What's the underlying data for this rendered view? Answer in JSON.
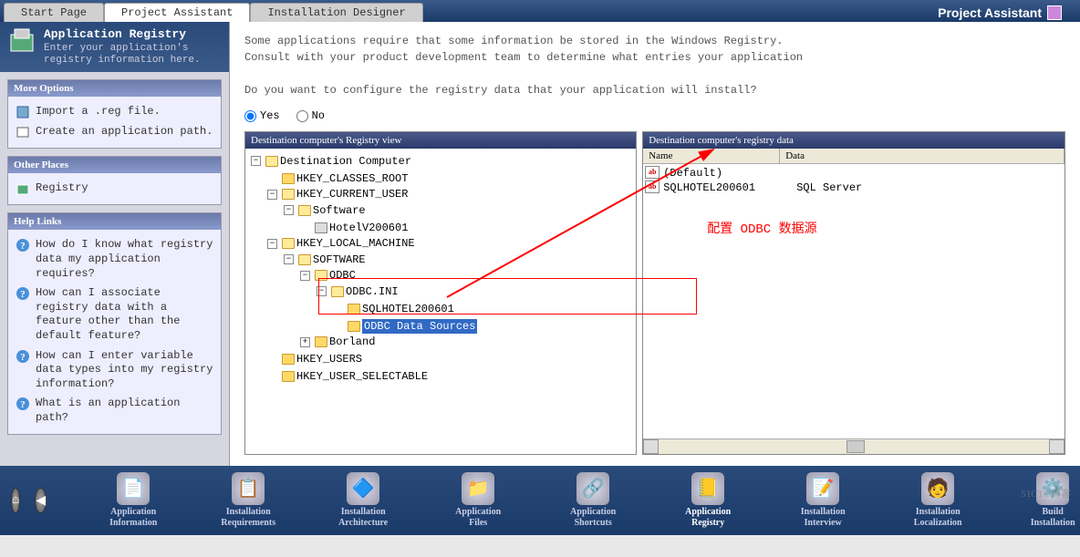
{
  "tabs": [
    "Start Page",
    "Project Assistant",
    "Installation Designer"
  ],
  "active_tab": 1,
  "app_title": "Project Assistant",
  "sidebar": {
    "header_title": "Application Registry",
    "header_desc": "Enter your application's registry information here.",
    "more_options_title": "More Options",
    "more_options": [
      "Import a .reg file.",
      "Create an application path."
    ],
    "other_places_title": "Other Places",
    "other_places": [
      "Registry"
    ],
    "help_title": "Help Links",
    "help_links": [
      "How do I know what registry data my application requires?",
      "How can I associate registry data with a feature other than the default feature?",
      "How can I enter variable data types into my registry information?",
      "What is an application path?"
    ]
  },
  "main": {
    "desc1": "Some applications require that some information be stored in the Windows Registry.",
    "desc2": "Consult with your product development team to determine what entries your application",
    "desc3": "Do you want to configure the registry data that your application will install?",
    "yes": "Yes",
    "no": "No",
    "tree_title": "Destination computer's Registry view",
    "data_title": "Destination computer's registry data",
    "col_name": "Name",
    "col_data": "Data",
    "tree": {
      "root": "Destination Computer",
      "hkcr": "HKEY_CLASSES_ROOT",
      "hkcu": "HKEY_CURRENT_USER",
      "software1": "Software",
      "hotel1": "HotelV200601",
      "hklm": "HKEY_LOCAL_MACHINE",
      "software2": "SOFTWARE",
      "odbc": "ODBC",
      "odbcini": "ODBC.INI",
      "sqlhotel": "SQLHOTEL200601",
      "datasources": "ODBC Data Sources",
      "borland": "Borland",
      "hku": "HKEY_USERS",
      "hkus": "HKEY_USER_SELECTABLE"
    },
    "registry_data": [
      {
        "name": "(Default)",
        "data": ""
      },
      {
        "name": "SQLHOTEL200601",
        "data": "SQL Server"
      }
    ],
    "annotation": "配置 ODBC 数据源"
  },
  "steps": [
    "Application\nInformation",
    "Installation\nRequirements",
    "Installation\nArchitecture",
    "Application\nFiles",
    "Application\nShortcuts",
    "Application\nRegistry",
    "Installation\nInterview",
    "Installation\nLocalization",
    "Build\nInstallation"
  ],
  "active_step": 5,
  "watermark": "51CTO博客"
}
